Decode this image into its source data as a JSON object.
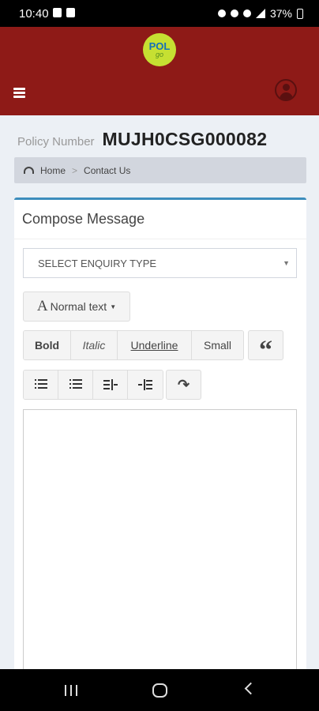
{
  "status_bar": {
    "time": "10:40",
    "battery": "37%"
  },
  "header": {
    "logo_text_main": "POL",
    "logo_text_sub": "go"
  },
  "policy": {
    "label": "Policy Number",
    "number": "MUJH0CSG000082"
  },
  "breadcrumb": {
    "home": "Home",
    "separator": ">",
    "current": "Contact Us"
  },
  "compose": {
    "title": "Compose Message",
    "enquiry_select": {
      "selected": "SELECT ENQUIRY TYPE"
    },
    "toolbar": {
      "font_style_A": "A",
      "font_style_label": "Normal text",
      "bold": "Bold",
      "italic": "Italic",
      "underline": "Underline",
      "small": "Small",
      "quote": "“"
    },
    "editor_value": ""
  },
  "icons": {
    "menu": "hamburger-icon",
    "user": "user-avatar-icon",
    "breadcrumb_home": "dashboard-icon",
    "unordered_list": "list-icon",
    "ordered_list": "ordered-list-icon",
    "outdent": "outdent-icon",
    "indent": "indent-icon",
    "redo": "redo-icon"
  },
  "colors": {
    "header_bg": "#8e1a17",
    "accent": "#3c8dbc",
    "logo_bg": "#c6e032"
  }
}
